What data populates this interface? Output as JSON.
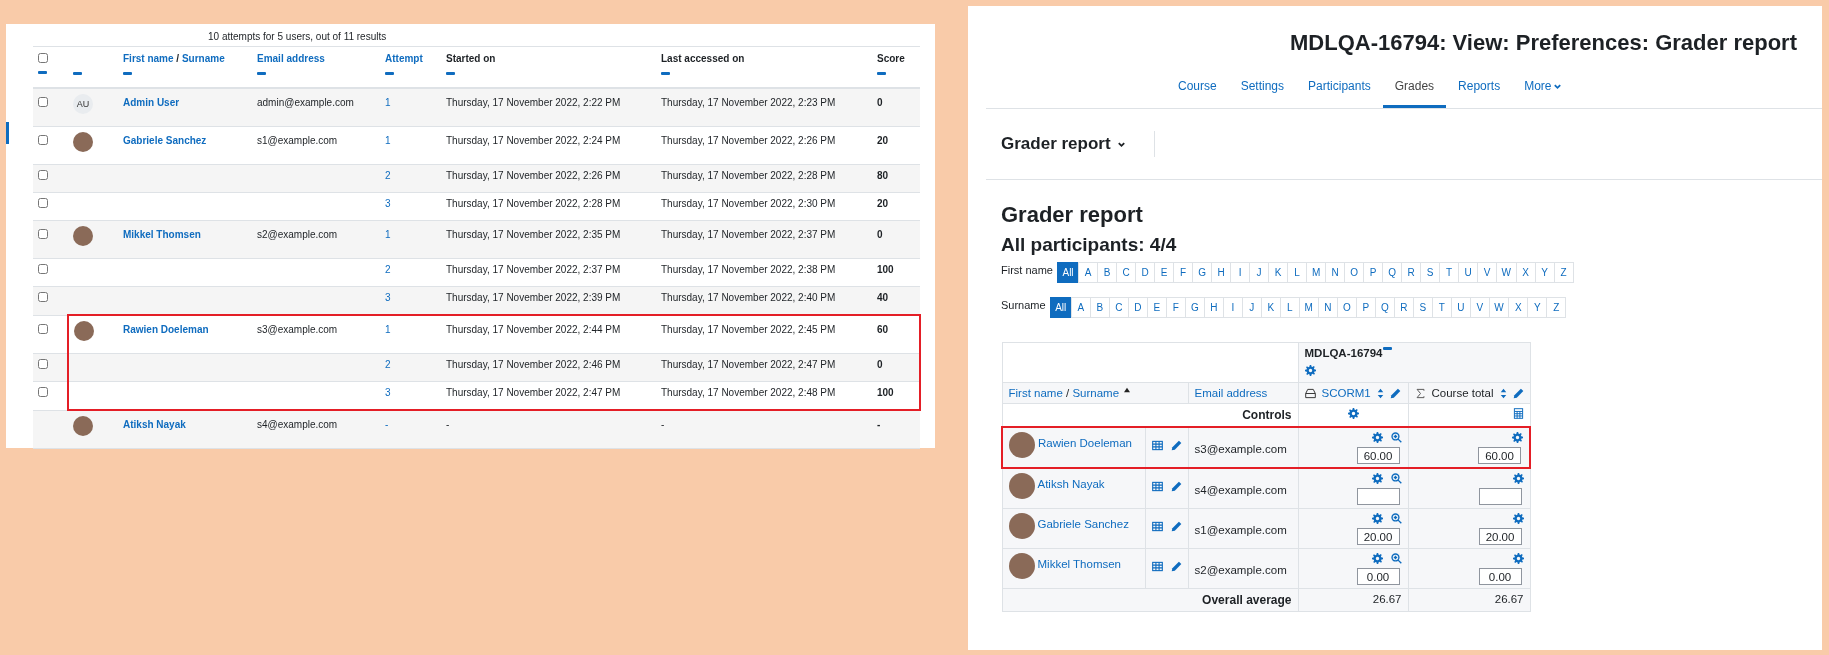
{
  "attempts_panel": {
    "summary": "10 attempts for 5 users, out of 11 results",
    "columns": [
      {
        "kind": "checkbox",
        "checked": false
      },
      {
        "kind": "blank"
      },
      {
        "kind": "name_sort",
        "labels": [
          "First name",
          "Surname"
        ],
        "separator": "/"
      },
      {
        "kind": "link",
        "label": "Email address"
      },
      {
        "kind": "link",
        "label": "Attempt"
      },
      {
        "kind": "text",
        "label": "Started on"
      },
      {
        "kind": "text",
        "label": "Last accessed on"
      },
      {
        "kind": "plain",
        "label": "Score"
      }
    ],
    "rows": [
      {
        "checked": false,
        "highlighted": false,
        "avatar": {
          "kind": "initials",
          "text": "AU"
        },
        "name": "Admin User",
        "email": "admin@example.com",
        "attempt": "1",
        "started": "Thursday, 17 November 2022, 2:22 PM",
        "last_accessed": "Thursday, 17 November 2022, 2:23 PM",
        "score": "0"
      },
      {
        "checked": false,
        "highlighted": false,
        "avatar": {
          "kind": "photo"
        },
        "name": "Gabriele Sanchez",
        "email": "s1@example.com",
        "attempt": "1",
        "started": "Thursday, 17 November 2022, 2:24 PM",
        "last_accessed": "Thursday, 17 November 2022, 2:26 PM",
        "score": "20"
      },
      {
        "checked": false,
        "highlighted": false,
        "attempt": "2",
        "started": "Thursday, 17 November 2022, 2:26 PM",
        "last_accessed": "Thursday, 17 November 2022, 2:28 PM",
        "score": "80"
      },
      {
        "checked": false,
        "highlighted": false,
        "attempt": "3",
        "started": "Thursday, 17 November 2022, 2:28 PM",
        "last_accessed": "Thursday, 17 November 2022, 2:30 PM",
        "score": "20"
      },
      {
        "checked": false,
        "highlighted": false,
        "avatar": {
          "kind": "photo"
        },
        "name": "Mikkel Thomsen",
        "email": "s2@example.com",
        "attempt": "1",
        "started": "Thursday, 17 November 2022, 2:35 PM",
        "last_accessed": "Thursday, 17 November 2022, 2:37 PM",
        "score": "0"
      },
      {
        "checked": false,
        "highlighted": false,
        "attempt": "2",
        "started": "Thursday, 17 November 2022, 2:37 PM",
        "last_accessed": "Thursday, 17 November 2022, 2:38 PM",
        "score": "100"
      },
      {
        "checked": false,
        "highlighted": false,
        "attempt": "3",
        "started": "Thursday, 17 November 2022, 2:39 PM",
        "last_accessed": "Thursday, 17 November 2022, 2:40 PM",
        "score": "40"
      },
      {
        "checked": false,
        "highlighted": true,
        "avatar": {
          "kind": "photo"
        },
        "name": "Rawien Doeleman",
        "email": "s3@example.com",
        "attempt": "1",
        "started": "Thursday, 17 November 2022, 2:44 PM",
        "last_accessed": "Thursday, 17 November 2022, 2:45 PM",
        "score": "60"
      },
      {
        "checked": false,
        "highlighted": true,
        "attempt": "2",
        "started": "Thursday, 17 November 2022, 2:46 PM",
        "last_accessed": "Thursday, 17 November 2022, 2:47 PM",
        "score": "0"
      },
      {
        "checked": false,
        "highlighted": true,
        "attempt": "3",
        "started": "Thursday, 17 November 2022, 2:47 PM",
        "last_accessed": "Thursday, 17 November 2022, 2:48 PM",
        "score": "100"
      },
      {
        "highlighted": false,
        "avatar": {
          "kind": "photo"
        },
        "name": "Atiksh Nayak",
        "email": "s4@example.com",
        "attempt": "-",
        "started": "-",
        "last_accessed": "-",
        "score": "-"
      }
    ]
  },
  "grader_panel": {
    "title": "MDLQA-16794: View: Preferences: Grader report",
    "nav": [
      {
        "label": "Course",
        "selected": false
      },
      {
        "label": "Settings",
        "selected": false
      },
      {
        "label": "Participants",
        "selected": false
      },
      {
        "label": "Grades",
        "selected": true
      },
      {
        "label": "Reports",
        "selected": false
      },
      {
        "label": "More",
        "selected": false,
        "kind": "dropdown"
      }
    ],
    "report_selector": "Grader report",
    "heading": "Grader report",
    "subheading": "All participants: 4/4",
    "initials_bars": [
      {
        "label": "First name",
        "letters": [
          {
            "label": "All",
            "selected": true
          },
          {
            "label": "A",
            "selected": false
          },
          {
            "label": "B",
            "selected": false
          },
          {
            "label": "C",
            "selected": false
          },
          {
            "label": "D",
            "selected": false
          },
          {
            "label": "E",
            "selected": false
          },
          {
            "label": "F",
            "selected": false
          },
          {
            "label": "G",
            "selected": false
          },
          {
            "label": "H",
            "selected": false
          },
          {
            "label": "I",
            "selected": false
          },
          {
            "label": "J",
            "selected": false
          },
          {
            "label": "K",
            "selected": false
          },
          {
            "label": "L",
            "selected": false
          },
          {
            "label": "M",
            "selected": false
          },
          {
            "label": "N",
            "selected": false
          },
          {
            "label": "O",
            "selected": false
          },
          {
            "label": "P",
            "selected": false
          },
          {
            "label": "Q",
            "selected": false
          },
          {
            "label": "R",
            "selected": false
          },
          {
            "label": "S",
            "selected": false
          },
          {
            "label": "T",
            "selected": false
          },
          {
            "label": "U",
            "selected": false
          },
          {
            "label": "V",
            "selected": false
          },
          {
            "label": "W",
            "selected": false
          },
          {
            "label": "X",
            "selected": false
          },
          {
            "label": "Y",
            "selected": false
          },
          {
            "label": "Z",
            "selected": false
          }
        ]
      },
      {
        "label": "Surname",
        "letters": [
          {
            "label": "All",
            "selected": true
          },
          {
            "label": "A",
            "selected": false
          },
          {
            "label": "B",
            "selected": false
          },
          {
            "label": "C",
            "selected": false
          },
          {
            "label": "D",
            "selected": false
          },
          {
            "label": "E",
            "selected": false
          },
          {
            "label": "F",
            "selected": false
          },
          {
            "label": "G",
            "selected": false
          },
          {
            "label": "H",
            "selected": false
          },
          {
            "label": "I",
            "selected": false
          },
          {
            "label": "J",
            "selected": false
          },
          {
            "label": "K",
            "selected": false
          },
          {
            "label": "L",
            "selected": false
          },
          {
            "label": "M",
            "selected": false
          },
          {
            "label": "N",
            "selected": false
          },
          {
            "label": "O",
            "selected": false
          },
          {
            "label": "P",
            "selected": false
          },
          {
            "label": "Q",
            "selected": false
          },
          {
            "label": "R",
            "selected": false
          },
          {
            "label": "S",
            "selected": false
          },
          {
            "label": "T",
            "selected": false
          },
          {
            "label": "U",
            "selected": false
          },
          {
            "label": "V",
            "selected": false
          },
          {
            "label": "W",
            "selected": false
          },
          {
            "label": "X",
            "selected": false
          },
          {
            "label": "Y",
            "selected": false
          },
          {
            "label": "Z",
            "selected": false
          }
        ]
      }
    ],
    "table": {
      "category": "MDLQA-16794",
      "name_sort": {
        "labels": [
          "First name",
          "Surname"
        ],
        "separator": "/"
      },
      "email_header": "Email address",
      "item_header": "SCORM1",
      "total_header": "Course total",
      "controls_label": "Controls",
      "rows": [
        {
          "name": "Rawien Doeleman",
          "email": "s3@example.com",
          "grade": "60.00",
          "total": "60.00",
          "highlighted": true
        },
        {
          "name": "Atiksh Nayak",
          "email": "s4@example.com",
          "highlighted": false
        },
        {
          "name": "Gabriele Sanchez",
          "email": "s1@example.com",
          "grade": "20.00",
          "total": "20.00",
          "highlighted": false
        },
        {
          "name": "Mikkel Thomsen",
          "email": "s2@example.com",
          "grade": "0.00",
          "total": "0.00",
          "highlighted": false
        }
      ],
      "average_label": "Overall average",
      "average_item": "26.67",
      "average_total": "26.67"
    }
  }
}
